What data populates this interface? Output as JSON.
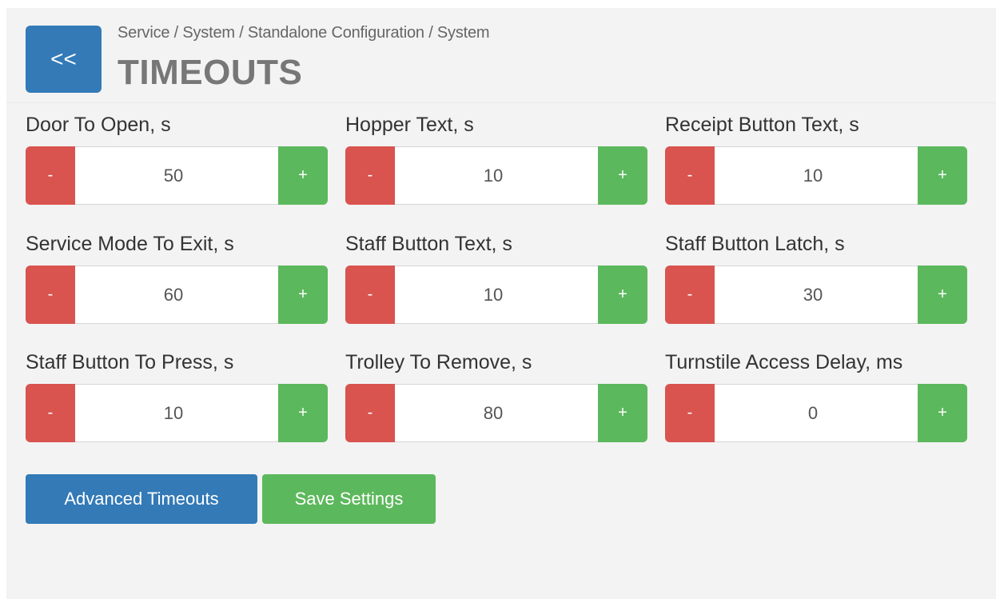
{
  "header": {
    "back_label": "<<",
    "breadcrumb": "Service / System / Standalone Configuration / System",
    "title": "TIMEOUTS"
  },
  "controls": {
    "minus_label": "-",
    "plus_label": "+"
  },
  "fields": [
    {
      "label": "Door To Open, s",
      "value": "50"
    },
    {
      "label": "Hopper Text, s",
      "value": "10"
    },
    {
      "label": "Receipt Button Text, s",
      "value": "10"
    },
    {
      "label": "Service Mode To Exit, s",
      "value": "60"
    },
    {
      "label": "Staff Button Text, s",
      "value": "10"
    },
    {
      "label": "Staff Button Latch, s",
      "value": "30"
    },
    {
      "label": "Staff Button To Press, s",
      "value": "10"
    },
    {
      "label": "Trolley To Remove, s",
      "value": "80"
    },
    {
      "label": "Turnstile Access Delay, ms",
      "value": "0"
    }
  ],
  "actions": {
    "advanced_label": "Advanced Timeouts",
    "save_label": "Save Settings"
  },
  "colors": {
    "primary": "#337ab7",
    "success": "#5cb85c",
    "danger": "#d9534f"
  }
}
